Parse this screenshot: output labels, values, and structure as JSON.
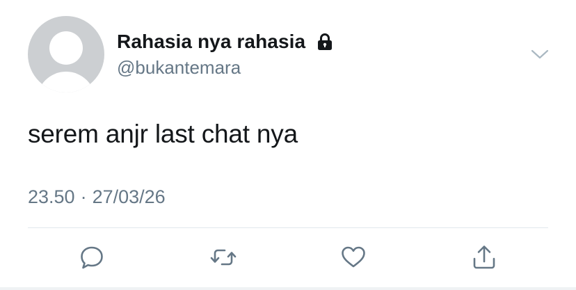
{
  "tweet": {
    "display_name": "Rahasia nya rahasia",
    "handle": "@bukantemara",
    "protected": true,
    "text": "serem anjr last chat nya",
    "time": "23.50",
    "separator": "·",
    "date": "27/03/26"
  },
  "icons": {
    "avatar": "default-avatar",
    "lock": "lock-icon",
    "menu": "chevron-down-icon",
    "reply": "reply-icon",
    "retweet": "retweet-icon",
    "like": "heart-icon",
    "share": "share-icon"
  },
  "colors": {
    "text_primary": "#14171a",
    "text_secondary": "#657786",
    "icon_gray": "#657786",
    "avatar_bg": "#cccfd2",
    "divider": "#e1e8ed"
  }
}
